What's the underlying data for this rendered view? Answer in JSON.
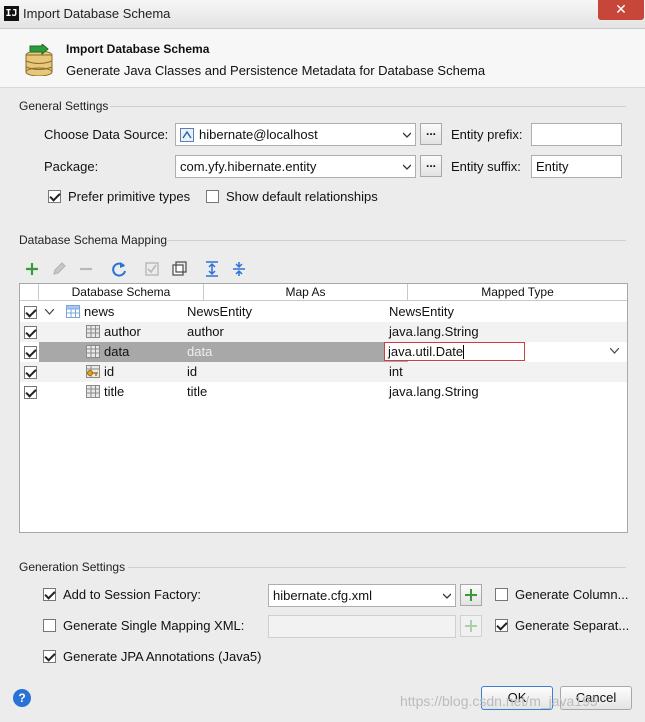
{
  "window": {
    "title": "Import Database Schema",
    "app_icon": "IJ",
    "close": "✕"
  },
  "header": {
    "title": "Import Database Schema",
    "subtitle": "Generate Java Classes and Persistence Metadata for Database Schema"
  },
  "general": {
    "section": "General Settings",
    "datasource_label": "Choose Data Source:",
    "datasource_value": "hibernate@localhost",
    "package_label": "Package:",
    "package_value": "com.yfy.hibernate.entity",
    "dots": "...",
    "prefix_label": "Entity prefix:",
    "prefix_value": "",
    "suffix_label": "Entity suffix:",
    "suffix_value": "Entity",
    "prefer_primitive": {
      "label": "Prefer primitive types",
      "checked": true
    },
    "show_default": {
      "label": "Show default relationships",
      "checked": false
    }
  },
  "mapping": {
    "section": "Database Schema Mapping",
    "toolbar": [
      "add-icon",
      "edit-icon",
      "remove-icon",
      "refresh-icon",
      "check-icon",
      "copy-icon",
      "expand-all-icon",
      "collapse-all-icon"
    ],
    "columns": [
      "Database Schema",
      "Map As",
      "Mapped Type"
    ],
    "rows": [
      {
        "name": "news",
        "map_as": "NewsEntity",
        "type": "NewsEntity",
        "checked": true,
        "kind": "table"
      },
      {
        "name": "author",
        "map_as": "author",
        "type": "java.lang.String",
        "checked": true,
        "kind": "column"
      },
      {
        "name": "data",
        "map_as": "data",
        "type": "java.util.Date",
        "checked": true,
        "kind": "column",
        "selected": true
      },
      {
        "name": "id",
        "map_as": "id",
        "type": "int",
        "checked": true,
        "kind": "key"
      },
      {
        "name": "title",
        "map_as": "title",
        "type": "java.lang.String",
        "checked": true,
        "kind": "column"
      }
    ]
  },
  "generation": {
    "section": "Generation Settings",
    "session_factory_label": "Add to Session Factory:",
    "session_factory_checked": true,
    "session_factory_value": "hibernate.cfg.xml",
    "single_mapping_label": "Generate Single Mapping XML:",
    "single_mapping_checked": false,
    "jpa_label": "Generate JPA Annotations (Java5)",
    "jpa_checked": true,
    "gen_column_label": "Generate Column...",
    "gen_column_checked": false,
    "gen_separate_label": "Generate Separat...",
    "gen_separate_checked": true
  },
  "buttons": {
    "ok": "OK",
    "cancel": "Cancel",
    "help": "?"
  },
  "watermark": "https://blog.csdn.net/m_java195",
  "colors": {
    "accent": "#2b72d6",
    "selected_row": "#a8a8a8",
    "edit_border": "#d33c3c",
    "green": "#3a9a3a"
  }
}
